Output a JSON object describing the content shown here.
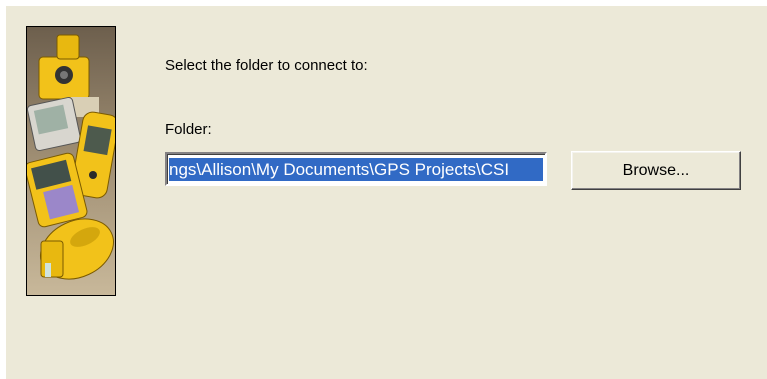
{
  "dialog": {
    "prompt": "Select the folder to connect to:",
    "folder_label": "Folder:",
    "folder_value": "ngs\\Allison\\My Documents\\GPS Projects\\CSI",
    "browse_label": "Browse..."
  },
  "side_image": {
    "description_icon": "survey-equipment-illustration"
  },
  "colors": {
    "dialog_background": "#ece9d8",
    "selection": "#316ac5",
    "equipment_yellow": "#f2c21a"
  }
}
